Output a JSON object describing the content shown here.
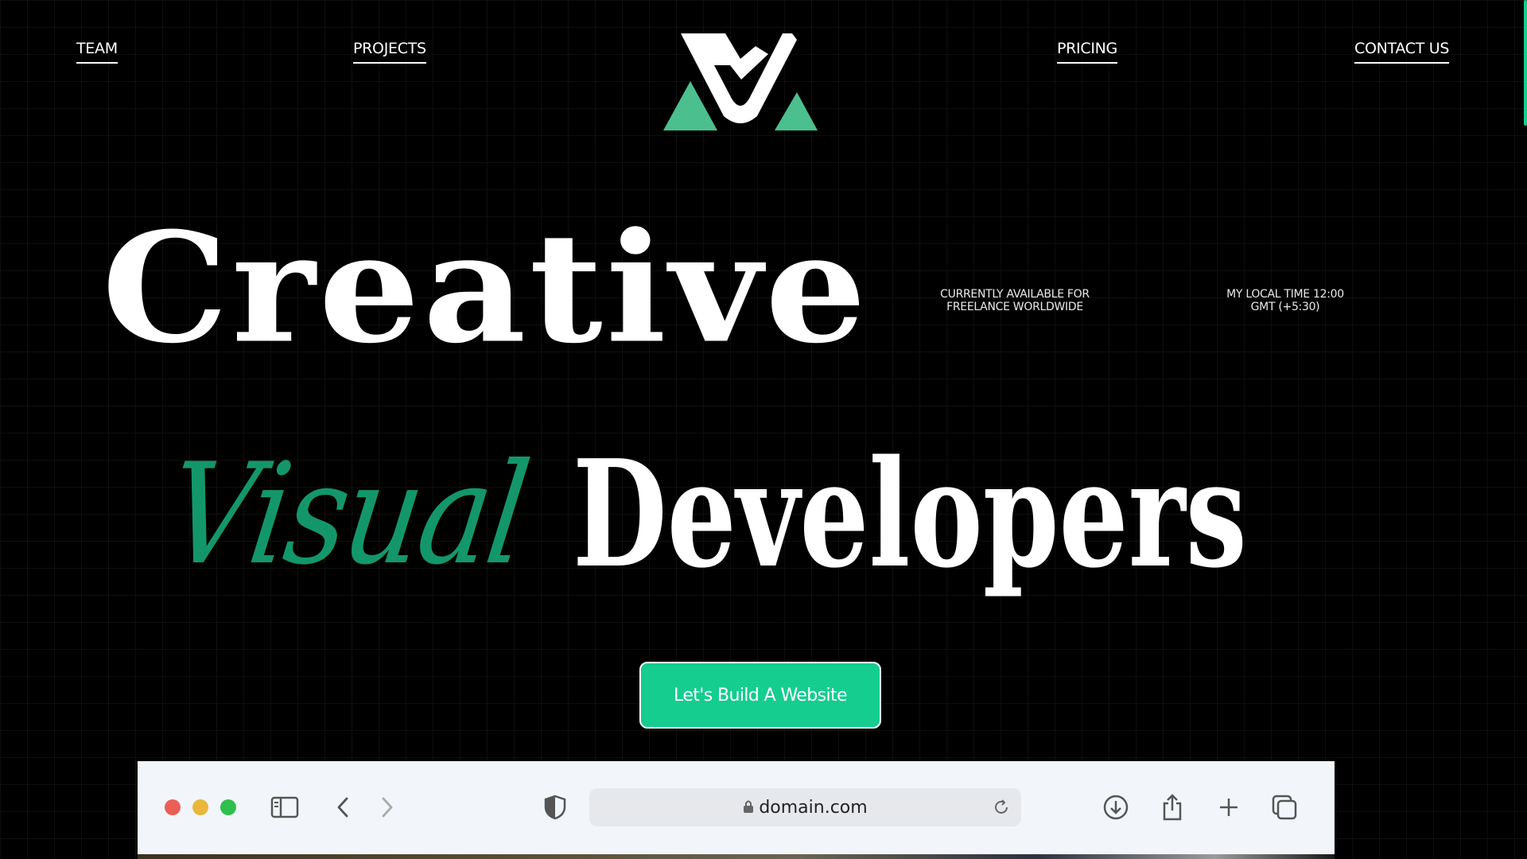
{
  "nav": {
    "team": "TEAM",
    "projects": "PROJECTS",
    "pricing": "PRICING",
    "contact": "CONTACT US"
  },
  "hero": {
    "line1": "Creative",
    "accent_word": "Visual",
    "line2": "Developers"
  },
  "info": {
    "availability_line1": "CURRENTLY AVAILABLE FOR",
    "availability_line2": "FREELANCE WORLDWIDE",
    "time_line1": "MY LOCAL TIME 12:00",
    "time_line2": "GMT (+5:30)"
  },
  "cta": {
    "label": "Let's Build A Website"
  },
  "browser": {
    "address": "domain.com",
    "icons": [
      "sidebar-icon",
      "back-icon",
      "forward-icon",
      "shield-icon",
      "lock-icon",
      "reload-icon",
      "download-icon",
      "share-icon",
      "new-tab-icon",
      "tabs-icon"
    ]
  },
  "colors": {
    "accent": "#14cd8f",
    "accent_dark": "#13976a",
    "logo_green": "#4cbf8f",
    "background": "#000000",
    "traffic_red": "#ec5f57",
    "traffic_yellow": "#e9b73c",
    "traffic_green": "#2fbf4d"
  }
}
